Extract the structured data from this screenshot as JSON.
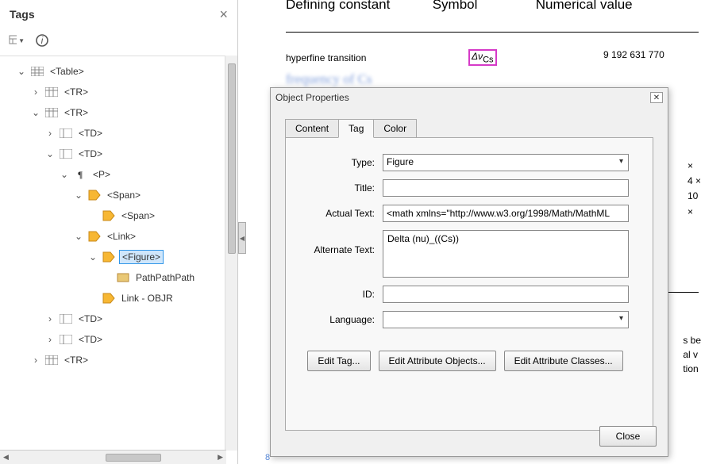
{
  "tags_panel": {
    "title": "Tags",
    "tree": {
      "table": "<Table>",
      "tr1": "<TR>",
      "tr2": "<TR>",
      "td1": "<TD>",
      "td2": "<TD>",
      "p": "<P>",
      "span1": "<Span>",
      "span2": "<Span>",
      "link": "<Link>",
      "figure": "<Figure>",
      "pathpath": "PathPathPath",
      "link_objr": "Link - OBJR",
      "td3": "<TD>",
      "td4": "<TD>",
      "tr3": "<TR>"
    }
  },
  "doc": {
    "th1": "Defining constant",
    "th2": "Symbol",
    "th3": "Numerical value",
    "row1_label": "hyperfine transition",
    "row1_symbol": "Δν",
    "row1_symbol_sub": "Cs",
    "row1_value": "9 192 631 770",
    "blur_text": "frequency of Cs",
    "right_vals": [
      "×",
      "4 ×",
      "10",
      "×"
    ],
    "right_text": [
      "s be",
      "al v",
      "tion"
    ],
    "footnum": "8"
  },
  "dialog": {
    "title": "Object Properties",
    "tabs": {
      "content": "Content",
      "tag": "Tag",
      "color": "Color"
    },
    "form": {
      "type_label": "Type:",
      "type_value": "Figure",
      "title_label": "Title:",
      "title_value": "",
      "actual_label": "Actual Text:",
      "actual_value": "<math xmlns=\"http://www.w3.org/1998/Math/MathML",
      "alt_label": "Alternate Text:",
      "alt_value": "Delta (nu)_((Cs))",
      "id_label": "ID:",
      "id_value": "",
      "lang_label": "Language:",
      "lang_value": ""
    },
    "buttons": {
      "edit_tag": "Edit Tag...",
      "edit_attr_obj": "Edit Attribute Objects...",
      "edit_attr_cls": "Edit Attribute Classes...",
      "close": "Close"
    }
  }
}
